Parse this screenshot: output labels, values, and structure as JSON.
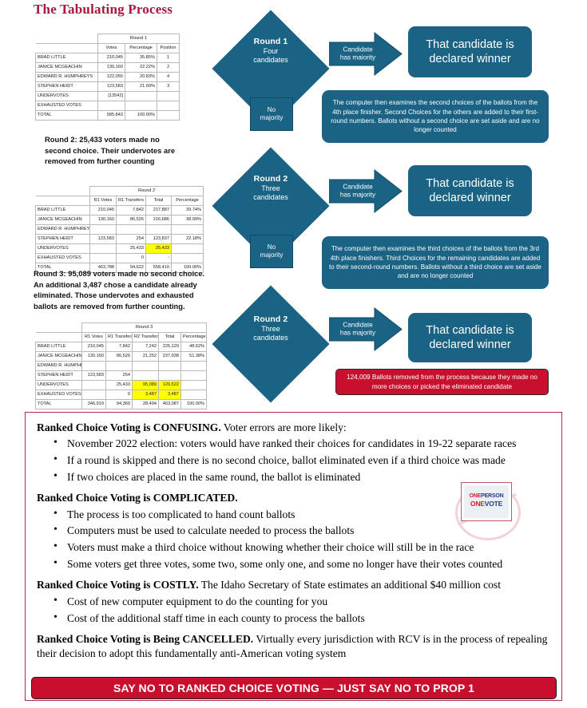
{
  "title": "The Tabulating Process",
  "tables": {
    "round1": {
      "group_header": "Round 1",
      "columns": [
        "",
        "Votes",
        "Percentage",
        "Position"
      ],
      "rows": [
        {
          "label": "BRAD LITTLE",
          "votes": "210,045",
          "pct": "35.85%",
          "pos": "1"
        },
        {
          "label": "JANICE MCGEACHIN",
          "votes": "130,160",
          "pct": "22.22%",
          "pos": "2"
        },
        {
          "label": "EDWARD R.  HUMPHREYS",
          "votes": "122,055",
          "pct": "20.83%",
          "pos": "4"
        },
        {
          "label": "STEPHEN HEIDT",
          "votes": "123,583",
          "pct": "21.09%",
          "pos": "3"
        },
        {
          "label": "UNDERVOTES",
          "votes": "[13542]",
          "pct": "",
          "pos": ""
        },
        {
          "label": "EXHAUSTED VOTES",
          "votes": "",
          "pct": "",
          "pos": ""
        },
        {
          "label": "TOTAL",
          "votes": "585,843",
          "pct": "100.00%",
          "pos": ""
        }
      ]
    },
    "round2": {
      "group_header": "Round 2",
      "columns": [
        "",
        "R1 Votes",
        "R1 Transfers",
        "Total",
        "Percentage"
      ],
      "rows": [
        {
          "label": "BRAD LITTLE",
          "r1": "210,045",
          "t1": "7,842",
          "total": "217,887",
          "pct": "39.74%",
          "hl_total": false
        },
        {
          "label": "JANICE MCGEACHIN",
          "r1": "130,160",
          "t1": "86,526",
          "total": "216,686",
          "pct": "38.09%",
          "hl_total": false
        },
        {
          "label": "EDWARD R.  HUMPHREYS",
          "r1": "",
          "t1": "",
          "total": "",
          "pct": "",
          "hl_total": false
        },
        {
          "label": "STEPHEN HEIDT",
          "r1": "123,583",
          "t1": "254",
          "total": "123,837",
          "pct": "22.18%",
          "hl_total": false
        },
        {
          "label": "UNDERVOTES",
          "r1": "",
          "t1": "25,433",
          "total": "25,433",
          "pct": "",
          "hl_total": true
        },
        {
          "label": "EXHAUSTED VOTES",
          "r1": "",
          "t1": "0",
          "total": "-",
          "pct": "",
          "hl_total": false
        },
        {
          "label": "TOTAL",
          "r1": "463,788",
          "t1": "94,622",
          "total": "558,410",
          "pct": "100.00%",
          "hl_total": false
        }
      ]
    },
    "round3": {
      "group_header": "Round 3",
      "columns": [
        "",
        "R1 Votes",
        "R1 Transfers",
        "R2 Transfers",
        "Total",
        "Percentage"
      ],
      "rows": [
        {
          "label": "BRAD LITTLE",
          "r1": "210,045",
          "t1": "7,842",
          "t2": "7,242",
          "total": "225,129",
          "pct": "48.62%",
          "hl_t2": false,
          "hl_total": false
        },
        {
          "label": "JANICE MCGEACHIN",
          "r1": "130,160",
          "t1": "86,526",
          "t2": "21,252",
          "total": "237,938",
          "pct": "51.38%",
          "hl_t2": false,
          "hl_total": false
        },
        {
          "label": "EDWARD R.  HUMPHREYS",
          "r1": "",
          "t1": "",
          "t2": "",
          "total": "",
          "pct": "",
          "hl_t2": false,
          "hl_total": false
        },
        {
          "label": "STEPHEN HEIDT",
          "r1": "123,583",
          "t1": "254",
          "t2": "",
          "total": "",
          "pct": "",
          "hl_t2": false,
          "hl_total": false
        },
        {
          "label": "UNDERVOTES",
          "r1": "",
          "t1": "25,433",
          "t2": "95,089",
          "total": "120,522",
          "pct": "",
          "hl_t2": true,
          "hl_total": true
        },
        {
          "label": "EXHAUSTED VOTES",
          "r1": "",
          "t1": "0",
          "t2": "3,487",
          "total": "3,487",
          "pct": "",
          "hl_t2": true,
          "hl_total": true
        },
        {
          "label": "TOTAL",
          "r1": "346,919",
          "t1": "94,369",
          "t2": "28,494",
          "total": "463,087",
          "pct": "100.00%",
          "hl_t2": false,
          "hl_total": false
        }
      ]
    }
  },
  "narratives": {
    "round2_lead": "Round 2:",
    "round2_text": " 25,433 voters made no second choice. Their undervotes are removed from further counting",
    "round3_lead": "Round 3:",
    "round3_text": " 95,089 voters made no second choice. An additional 3,487 chose a candidate already eliminated. Those undervotes and exhausted ballots are removed from further counting."
  },
  "flow": {
    "diamond1": {
      "big": "Round 1",
      "small": "Four\ncandidates"
    },
    "diamond2": {
      "big": "Round 2",
      "small": "Three\ncandidates"
    },
    "diamond3": {
      "big": "Round 2",
      "small": "Three\ncandidates"
    },
    "arrow1_label": "Candidate\nhas maiority",
    "arrow2_label": "Candidate\nhas majority",
    "arrow3_label": "Candidate\nhas majority",
    "winner1": "That candidate is declared winner",
    "winner2": "That candidate is declared winner",
    "winner3": "That candidate is declared winner",
    "no_majority1": "No\nmajority",
    "no_majority2": "No\nmajority",
    "explain1": "The computer then examines the second choices of the ballots from the 4th place finisher. Second Choices for the others are added to their first-round numbers. Ballots without a second choice are set aside and are no longer counted",
    "explain2": "The computer then examines the third choices of the ballots from the 3rd 4th place finishers. Third Choices for the remaining candidates are added to their second-round numbers. Ballots without a third choice are set aside and are no longer counted",
    "removed_ballots": "124,009 Ballots removed from the process because they made no more choices or picked the eliminated candidate"
  },
  "panel": {
    "sections": [
      {
        "lead": "Ranked Choice Voting is CONFUSING.",
        "rest": "  Voter errors are more likely:",
        "bullets": [
          "November 2022 election: voters would have ranked their choices for candidates in 19-22 separate races",
          "If a round is skipped and there is no second choice, ballot eliminated even if a third choice was made",
          "If two choices are placed in the same round, the ballot is eliminated"
        ]
      },
      {
        "lead": "Ranked Choice Voting is COMPLICATED.",
        "rest": "",
        "bullets": [
          "The process is too complicated to hand count ballots",
          "Computers must be used to calculate needed to process the ballots",
          "Voters must make a third choice without knowing whether their choice will still be in the race",
          "Some voters get three votes, some two, some only one, and some no longer have their votes counted"
        ]
      },
      {
        "lead": "Ranked Choice Voting is COSTLY.",
        "rest": "  The Idaho Secretary of State estimates an additional $40 million cost",
        "bullets": [
          "Cost of new computer equipment to do the counting for you",
          "Cost of the additional staff time in each county to process the ballots"
        ]
      },
      {
        "lead": "Ranked Choice Voting is Being CANCELLED.",
        "rest": "  Virtually every jurisdiction with RCV is in the process of repealing their decision to adopt this fundamentally anti-American voting system",
        "bullets": []
      }
    ]
  },
  "logo": {
    "line1_a": "ONE",
    "line1_b": "PERSON",
    "line2_a": "ONE",
    "line2_b": "VOTE"
  },
  "cta": "SAY NO TO RANKED CHOICE VOTING — JUST SAY NO TO PROP 1",
  "colors": {
    "teal": "#1a6384",
    "crimson": "#c8102e",
    "title_red": "#a8173c",
    "highlight": "#ffff00"
  }
}
